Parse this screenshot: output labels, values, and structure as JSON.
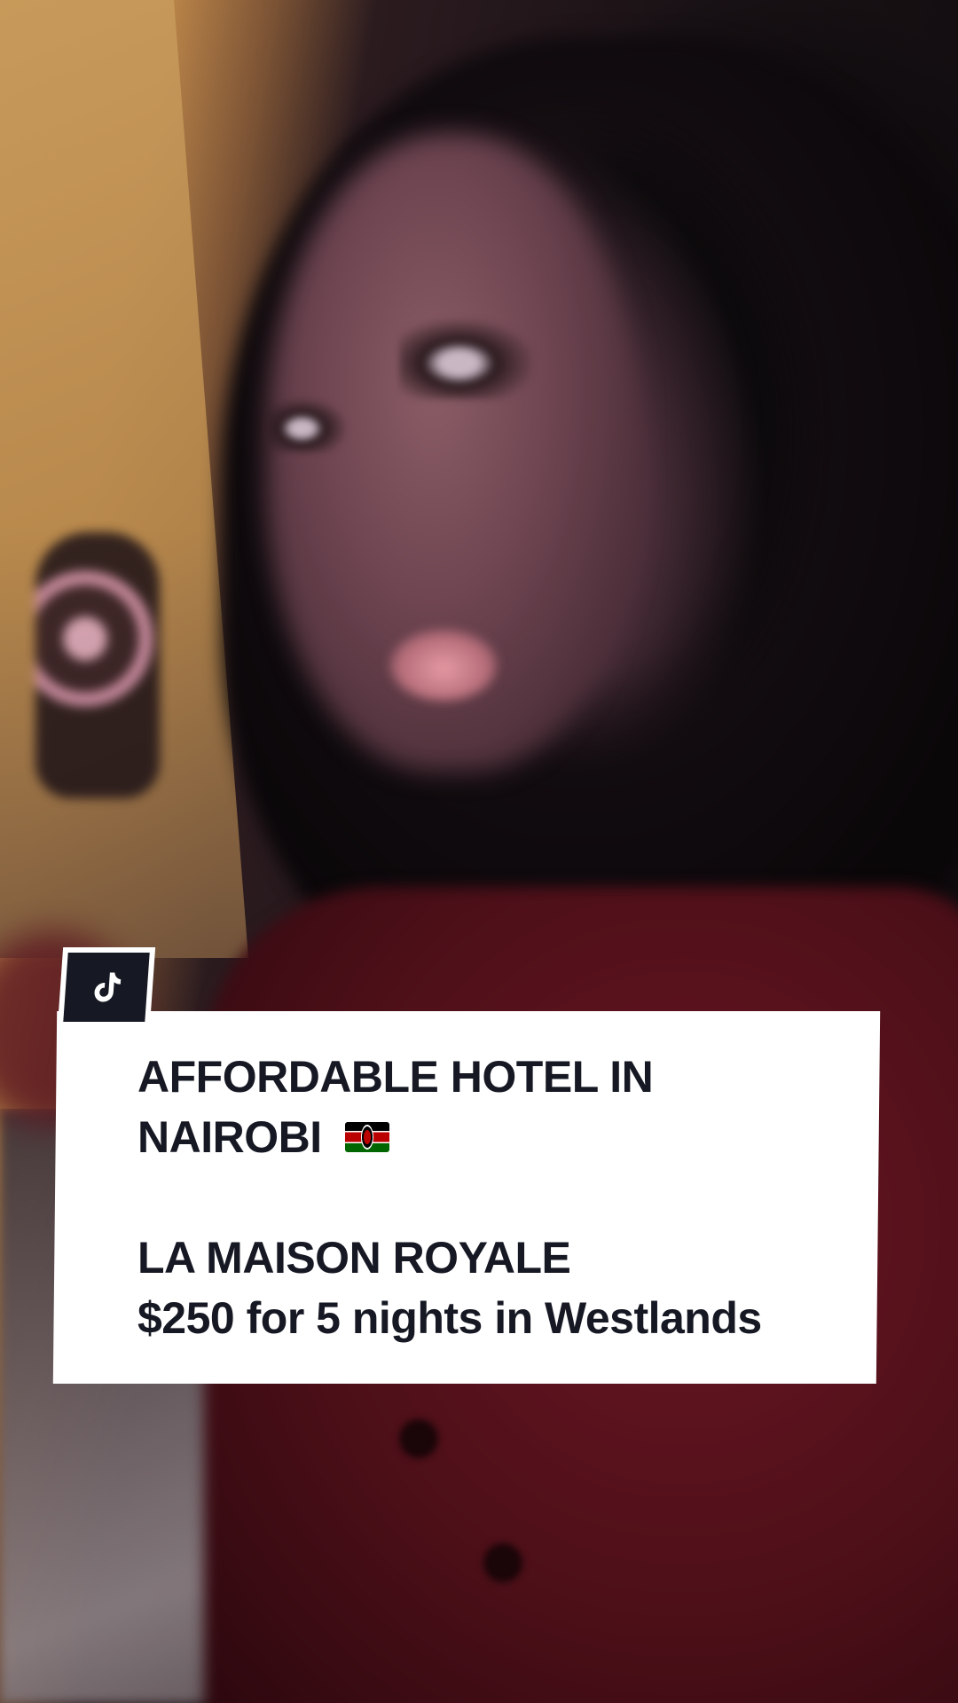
{
  "overlay": {
    "logo_icon": "tiktok-icon",
    "caption": {
      "line1": "AFFORDABLE HOTEL IN",
      "line2": "NAIROBI",
      "flag_icon": "kenya-flag-icon",
      "line3": "LA MAISON ROYALE",
      "line4": "$250 for 5 nights in Westlands"
    },
    "text_color": "#161823",
    "card_color": "#ffffff"
  }
}
